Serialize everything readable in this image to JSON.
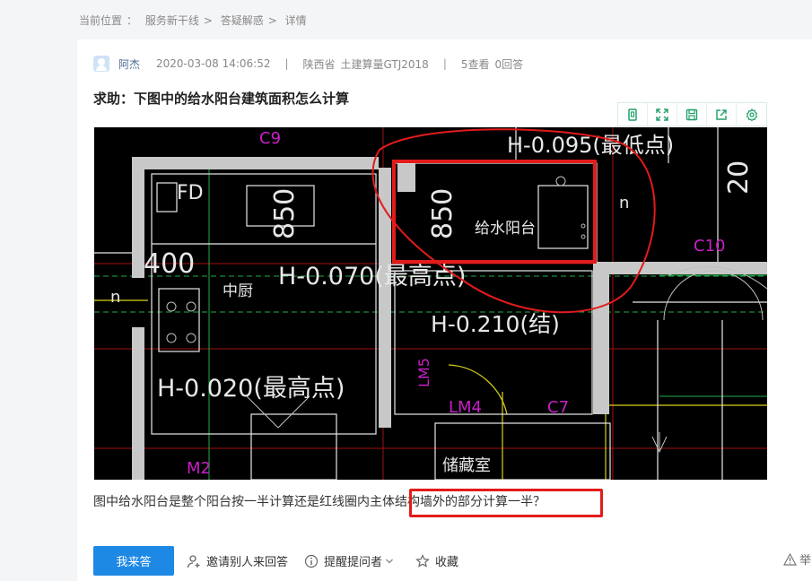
{
  "breadcrumb": {
    "label": "当前位置",
    "sep": "：",
    "items": [
      "服务新干线",
      "答疑解惑",
      "详情"
    ],
    "arrow": ">"
  },
  "post": {
    "author": "阿杰",
    "datetime": "2020-03-08 14:06:52",
    "region": "陕西省",
    "product": "土建算量GTJ2018",
    "views": "5查看",
    "answers": "0回答",
    "title": "求助：下图中的给水阳台建筑面积怎么计算",
    "question_before": "图中给水阳台是整个阳台按一半计算还是红线圈内",
    "question_highlight": "主体结构墙外的部分计算一半",
    "question_after": "？"
  },
  "image_toolbar": {
    "icons": [
      "original-size-icon",
      "fullscreen-icon",
      "save-icon",
      "share-icon",
      "settings-icon"
    ],
    "color": "#22a06b"
  },
  "cad": {
    "labels": {
      "fd": "FD",
      "dim850a": "850",
      "dim850b": "850",
      "balcony": "给水阳台",
      "h0095": "H-0.095(最低点)",
      "h0070": "H-0.070(最高点)",
      "h0210": "H-0.210(结)",
      "h0020": "H-0.020(最高点)",
      "kitchen": "中厨",
      "storage": "储藏室",
      "c9": "C9",
      "c10": "C10",
      "c7": "C7",
      "lm4": "LM4",
      "lm5": "LM5",
      "m2": "M2",
      "n1": "n",
      "n2": "n",
      "dim400": "400",
      "dim20": "20"
    },
    "colors": {
      "annotation": "#e21b1b",
      "wall": "#c8c8c8",
      "line": "#e8e8e8",
      "magenta": "#c81fc8",
      "yellow": "#d7d21a",
      "green": "#1fae4a",
      "red": "#d01010"
    }
  },
  "actions": {
    "answer": "我来答",
    "invite": "邀请别人来回答",
    "remind": "提醒提问者",
    "collect": "收藏",
    "report": "举"
  }
}
